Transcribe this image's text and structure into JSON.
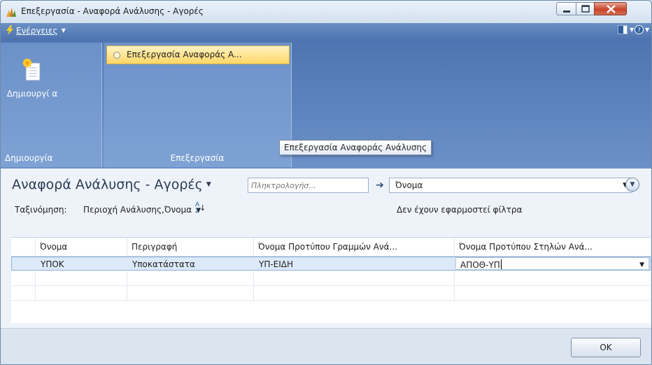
{
  "window": {
    "title": "Επεξεργασία - Αναφορά Ανάλυσης - Αγορές"
  },
  "actionbar": {
    "actions_label": "Ενέργειες"
  },
  "ribbon": {
    "create_group": {
      "new_button_label": "Δημιουργί α",
      "group_label": "Δημιουργία"
    },
    "edit_group": {
      "edit_button_label": "Επεξεργασία Αναφοράς Α...",
      "group_label": "Επεξεργασία"
    },
    "tooltip": "Επεξεργασία Αναφοράς Ανάλυσης"
  },
  "page": {
    "title": "Αναφορά Ανάλυσης - Αγορές",
    "search_placeholder": "Πληκτρολογήσ...",
    "search_field": "Όνομα",
    "sort_label": "Ταξινόμηση:",
    "sort_value": "Περιοχή Ανάλυσης,Όνομα",
    "sort_direction_top": "A",
    "sort_direction_bottom": "Z",
    "filter_status": "Δεν έχουν εφαρμοστεί φίλτρα"
  },
  "grid": {
    "columns": [
      "Όνομα",
      "Περιγραφή",
      "Όνομα Προτύπου Γραμμών Ανά...",
      "Όνομα Προτύπου Στηλών Ανά..."
    ],
    "rows": [
      [
        "ΥΠΟΚ",
        "Υποκατάστατα",
        "ΥΠ-ΕΙΔΗ",
        "ΑΠΟΘ-ΥΠ"
      ]
    ]
  },
  "footer": {
    "ok_label": "OK"
  }
}
